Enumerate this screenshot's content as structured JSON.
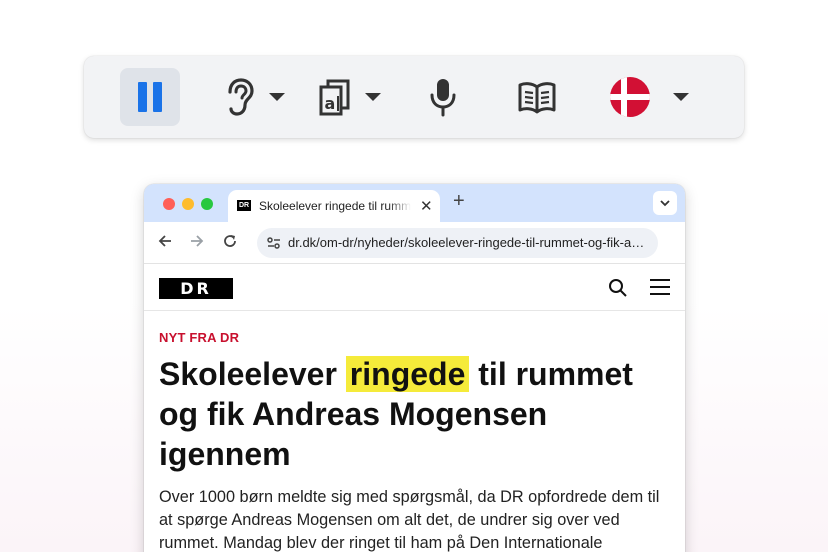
{
  "toolbar": {
    "pause_icon": "pause-icon",
    "listen_icon": "ear-icon",
    "read_icon": "text-reader-icon",
    "mic_icon": "microphone-icon",
    "book_icon": "open-book-icon",
    "language_icon": "denmark-flag-icon",
    "accent_color": "#1a73e8"
  },
  "browser": {
    "tab": {
      "favicon_text": "DR",
      "title": "Skoleelever ringede til rummet og fik Andreas Mogensen igennem",
      "close": "✕"
    },
    "new_tab": "+",
    "address": "dr.dk/om-dr/nyheder/skoleelever-ringede-til-rummet-og-fik-andreas-mogensen-igennem"
  },
  "page": {
    "logo": "DR",
    "kicker": "NYT FRA DR",
    "headline": {
      "before": "Skoleelever ",
      "highlighted": "ringede",
      "after": " til rummet og fik Andreas Mogensen igennem"
    },
    "lead": "Over 1000 børn meldte sig med spørgsmål, da DR opfordrede dem til at spørge Andreas Mogensen om alt det, de undrer sig over ved rummet. Mandag blev der ringet til ham på Den Internationale",
    "highlight_color": "#f5eb3a",
    "kicker_color": "#c8102e"
  }
}
